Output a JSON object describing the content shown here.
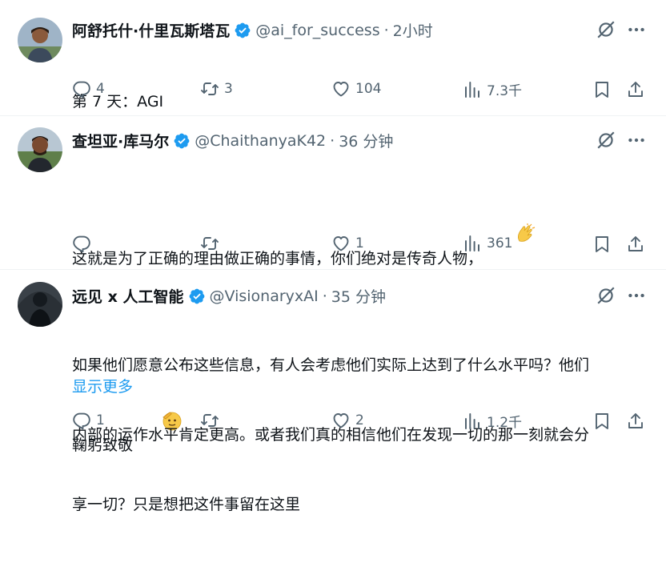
{
  "tweets": [
    {
      "name": "阿舒托什·什里瓦斯塔瓦",
      "handle": "@ai_for_success",
      "dot": "·",
      "time": "2小时",
      "lines": [
        "第 7 天：AGI"
      ],
      "replies": "4",
      "retweets": "3",
      "likes": "104",
      "views": "7.3千"
    },
    {
      "name": "查坦亚·库马尔",
      "handle": "@ChaithanyaK42",
      "dot": "·",
      "time": "36 分钟",
      "lines": [
        "这就是为了正确的理由做正确的事情，你们绝对是传奇人物，",
        "鞠躬致敬"
      ],
      "replies": "",
      "retweets": "",
      "likes": "1",
      "views": "361"
    },
    {
      "name": "远见 x 人工智能",
      "handle": "@VisionaryxAI",
      "dot": "·",
      "time": "35 分钟",
      "lines": [
        "如果他们愿意公布这些信息，有人会考虑他们实际上达到了什么水平吗？他们",
        "内部的运作水平肯定更高。或者我们真的相信他们在发现一切的那一刻就会分",
        "享一切？只是想把这件事留在这里"
      ],
      "show_more": "显示更多",
      "replies": "1",
      "retweets": "",
      "likes": "2",
      "views": "1.2千"
    }
  ],
  "icons": {
    "verified": "verified-badge-icon",
    "grok": "grok-icon",
    "more": "more-icon",
    "reply": "reply-icon",
    "retweet": "retweet-icon",
    "like": "heart-icon",
    "views": "views-icon",
    "bookmark": "bookmark-icon",
    "share": "share-icon",
    "clap": "clapping-hands-emoji",
    "salute": "saluting-face-emoji"
  },
  "colors": {
    "text": "#0f1419",
    "secondary": "#536471",
    "accent": "#1d9bf0",
    "divider": "#eff3f4"
  }
}
